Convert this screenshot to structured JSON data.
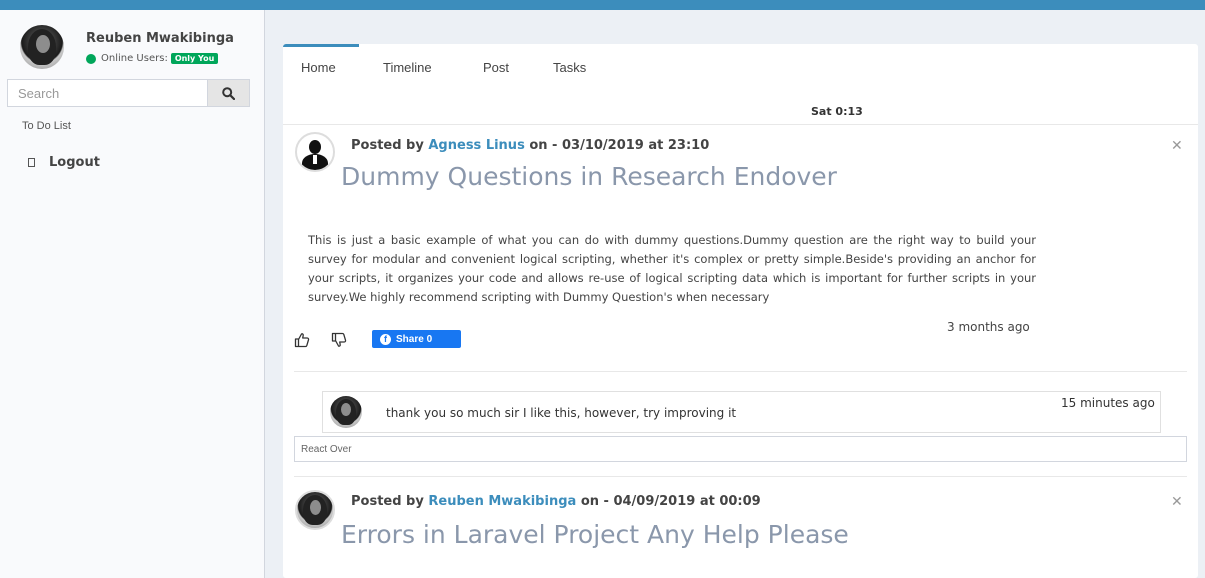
{
  "sidebar": {
    "user_name": "Reuben Mwakibinga",
    "online_label": "Online Users:",
    "online_badge": "Only You",
    "search_placeholder": "Search",
    "todo_label": "To Do List",
    "logout_label": "Logout"
  },
  "tabs": [
    {
      "label": "Home",
      "active": true
    },
    {
      "label": "Timeline",
      "active": false
    },
    {
      "label": "Post",
      "active": false
    },
    {
      "label": "Tasks",
      "active": false
    }
  ],
  "clock": "Sat 0:13",
  "posts": [
    {
      "posted_prefix": "Posted by",
      "author": "Agness Linus",
      "posted_suffix": "on - 03/10/2019 at 23:10",
      "title": "Dummy Questions in Research Endover",
      "body": "This is just a basic example of what you can do with dummy questions.Dummy question are the right way to build your survey for modular and convenient logical scripting, whether it's complex or pretty simple.Beside's providing an anchor for your scripts, it organizes your code and allows re-use of logical scripting data which is important for further scripts in your survey.We highly recommend scripting with Dummy Question's when necessary",
      "time_ago": "3 months ago",
      "share_label": "Share 0",
      "comments": [
        {
          "text": "thank you so much sir I like this, however, try improving it",
          "time_ago": "15 minutes ago"
        }
      ],
      "react_placeholder": "React Over"
    },
    {
      "posted_prefix": "Posted by",
      "author": "Reuben Mwakibinga",
      "posted_suffix": "on - 04/09/2019 at 00:09",
      "title": "Errors in Laravel Project Any Help Please"
    }
  ],
  "colors": {
    "header": "#3c8dbc",
    "link": "#3c8dbc",
    "online": "#00a65a",
    "facebook": "#1877f2",
    "title": "#8a97ab"
  },
  "icons": [
    "search-icon",
    "logout-icon",
    "like-icon",
    "dislike-icon",
    "facebook-icon",
    "close-icon"
  ]
}
